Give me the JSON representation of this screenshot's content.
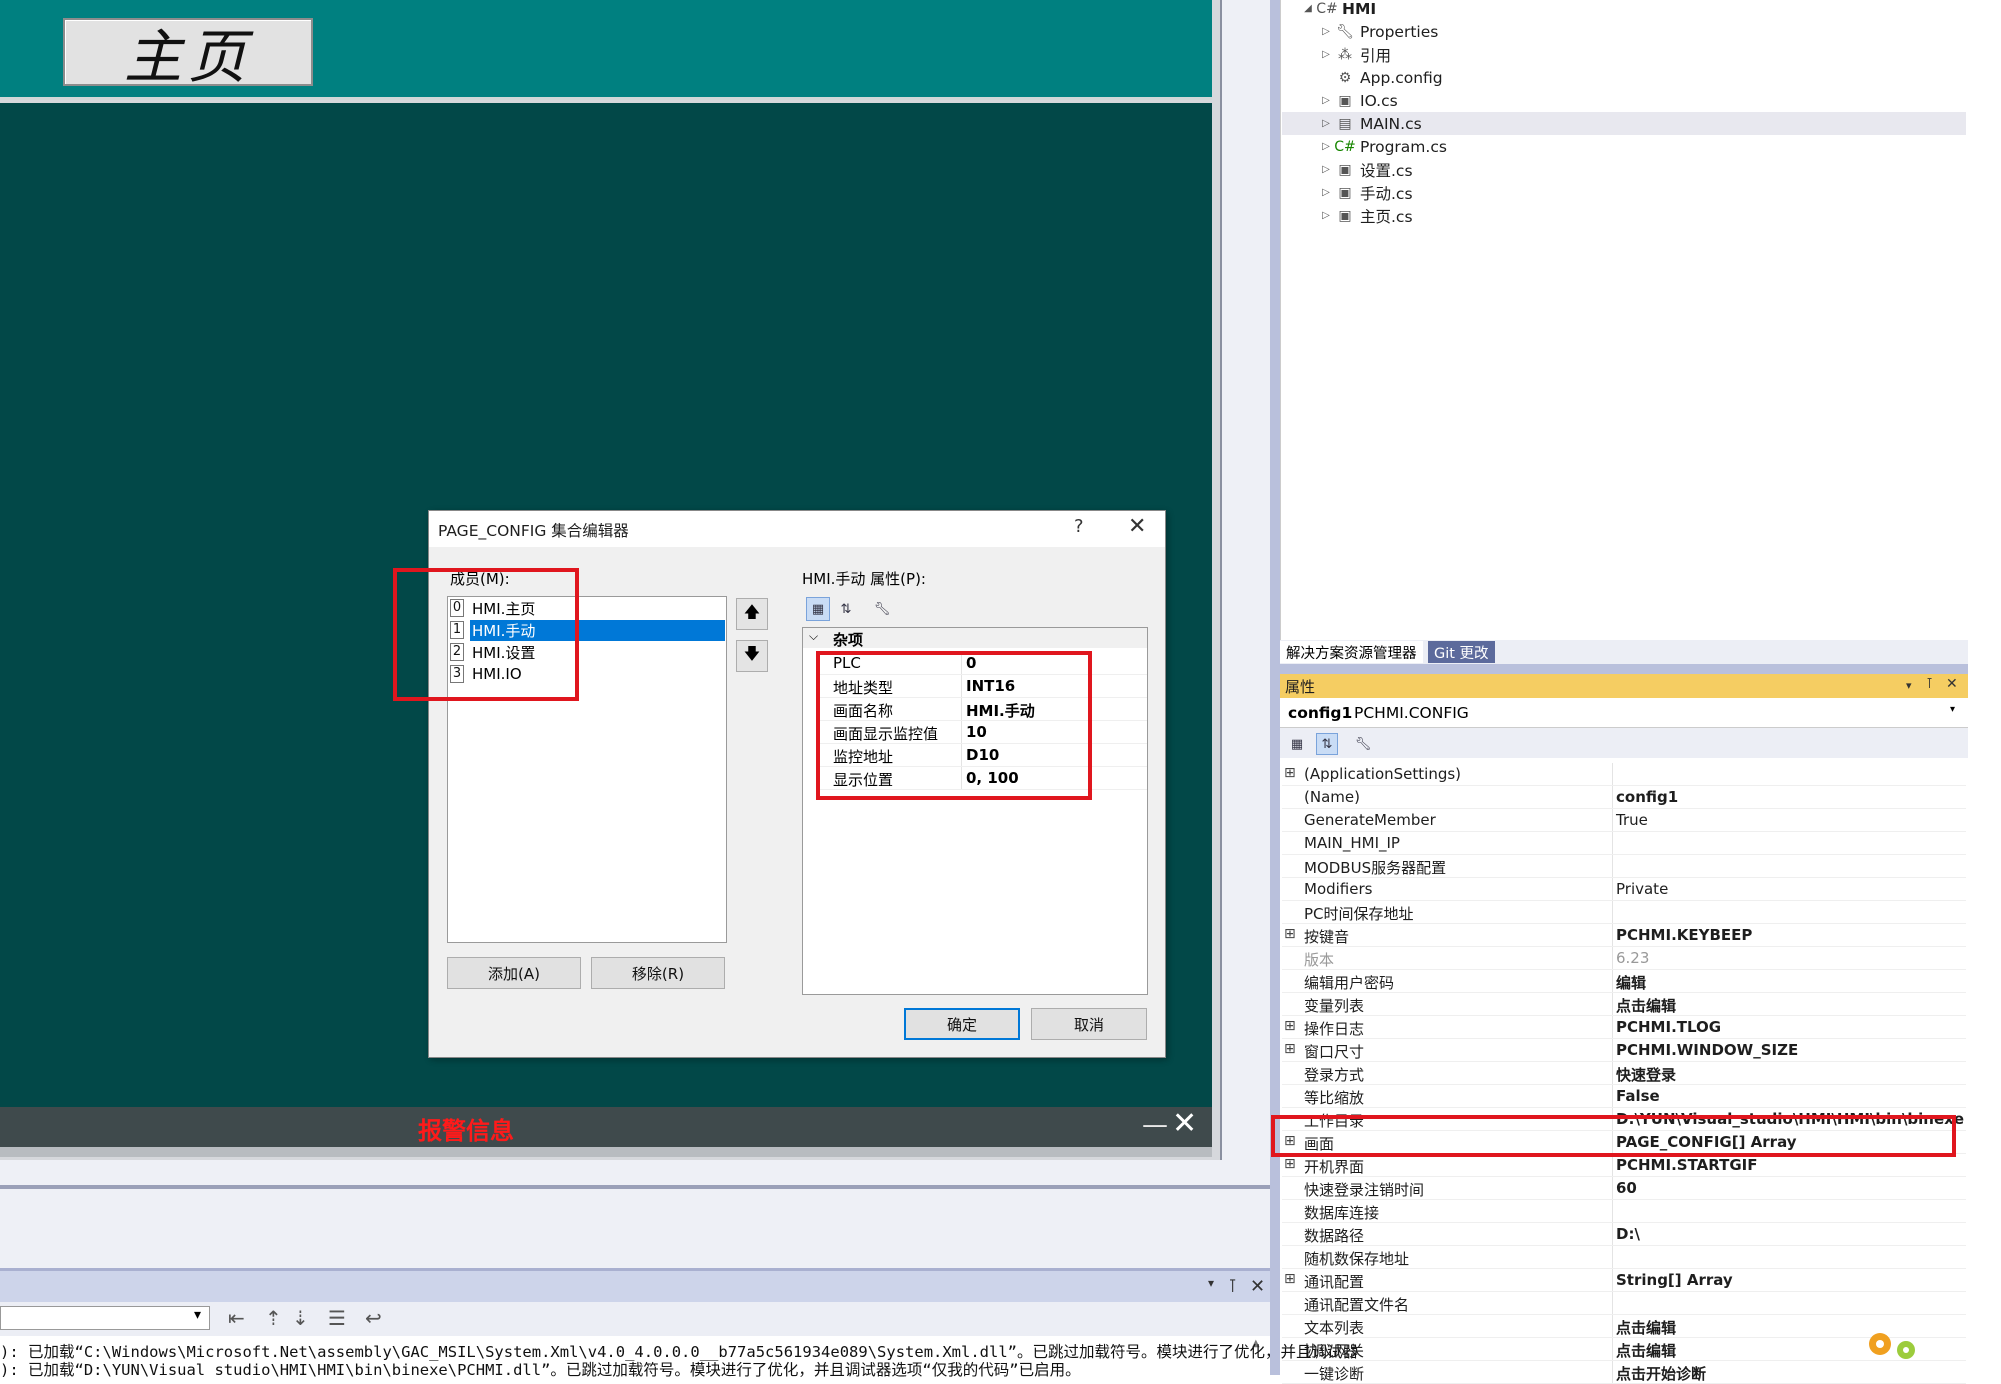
{
  "hmi": {
    "home_button": "主页",
    "alarm_title": "报警信息",
    "alarm_min": "—",
    "alarm_close": "✕"
  },
  "solution_explorer": {
    "items": [
      {
        "label": "HMI",
        "icon": "csharp-project-icon",
        "bold": true
      },
      {
        "label": "Properties",
        "icon": "wrench-icon"
      },
      {
        "label": "引用",
        "icon": "references-icon"
      },
      {
        "label": "App.config",
        "icon": "config-file-icon"
      },
      {
        "label": "IO.cs",
        "icon": "form-icon"
      },
      {
        "label": "MAIN.cs",
        "icon": "component-icon"
      },
      {
        "label": "Program.cs",
        "icon": "csharp-file-icon"
      },
      {
        "label": "设置.cs",
        "icon": "form-icon"
      },
      {
        "label": "手动.cs",
        "icon": "form-icon"
      },
      {
        "label": "主页.cs",
        "icon": "form-icon"
      }
    ],
    "tabs": [
      "解决方案资源管理器",
      "Git 更改"
    ]
  },
  "properties": {
    "title": "属性",
    "object_name": "config1",
    "object_type": "PCHMI.CONFIG",
    "rows": [
      {
        "expand": "⊞",
        "name": "(ApplicationSettings)",
        "value": ""
      },
      {
        "expand": "",
        "name": "(Name)",
        "value": "config1",
        "bold": true
      },
      {
        "expand": "",
        "name": "GenerateMember",
        "value": "True"
      },
      {
        "expand": "",
        "name": "MAIN_HMI_IP",
        "value": ""
      },
      {
        "expand": "",
        "name": "MODBUS服务器配置",
        "value": ""
      },
      {
        "expand": "",
        "name": "Modifiers",
        "value": "Private"
      },
      {
        "expand": "",
        "name": "PC时间保存地址",
        "value": ""
      },
      {
        "expand": "⊞",
        "name": "按键音",
        "value": "PCHMI.KEYBEEP",
        "bold": true
      },
      {
        "expand": "",
        "name": "版本",
        "value": "6.23",
        "gray": true
      },
      {
        "expand": "",
        "name": "编辑用户密码",
        "value": "编辑",
        "bold": true
      },
      {
        "expand": "",
        "name": "变量列表",
        "value": "点击编辑",
        "bold": true
      },
      {
        "expand": "⊞",
        "name": "操作日志",
        "value": "PCHMI.TLOG",
        "bold": true
      },
      {
        "expand": "⊞",
        "name": "窗口尺寸",
        "value": "PCHMI.WINDOW_SIZE",
        "bold": true
      },
      {
        "expand": "",
        "name": "登录方式",
        "value": "快速登录",
        "bold": true
      },
      {
        "expand": "",
        "name": "等比缩放",
        "value": "False",
        "bold": true
      },
      {
        "expand": "",
        "name": "工作目录",
        "value": "D:\\YUN\\Visual_studio\\HMI\\HMI\\bin\\binexe",
        "bold": true
      },
      {
        "expand": "⊞",
        "name": "画面",
        "value": "PAGE_CONFIG[] Array",
        "bold": true
      },
      {
        "expand": "⊞",
        "name": "开机界面",
        "value": "PCHMI.STARTGIF",
        "bold": true
      },
      {
        "expand": "",
        "name": "快速登录注销时间",
        "value": "60",
        "bold": true
      },
      {
        "expand": "",
        "name": "数据库连接",
        "value": ""
      },
      {
        "expand": "",
        "name": "数据路径",
        "value": "D:\\",
        "bold": true
      },
      {
        "expand": "",
        "name": "随机数保存地址",
        "value": ""
      },
      {
        "expand": "⊞",
        "name": "通讯配置",
        "value": "String[] Array",
        "bold": true
      },
      {
        "expand": "",
        "name": "通讯配置文件名",
        "value": ""
      },
      {
        "expand": "",
        "name": "文本列表",
        "value": "点击编辑",
        "bold": true
      },
      {
        "expand": "",
        "name": "协议网关",
        "value": "点击编辑",
        "bold": true
      },
      {
        "expand": "",
        "name": "一键诊断",
        "value": "点击开始诊断",
        "bold": true
      }
    ]
  },
  "dialog": {
    "title": "PAGE_CONFIG 集合编辑器",
    "help": "?",
    "close": "✕",
    "members_label": "成员(M):",
    "members": [
      {
        "index": "0",
        "label": "HMI.主页"
      },
      {
        "index": "1",
        "label": "HMI.手动",
        "selected": true
      },
      {
        "index": "2",
        "label": "HMI.设置"
      },
      {
        "index": "3",
        "label": "HMI.IO"
      }
    ],
    "add_button": "添加(A)",
    "remove_button": "移除(R)",
    "props_label": "HMI.手动 属性(P):",
    "category": "杂项",
    "props": [
      {
        "name": "PLC",
        "value": "0"
      },
      {
        "name": "地址类型",
        "value": "INT16"
      },
      {
        "name": "画面名称",
        "value": "HMI.手动"
      },
      {
        "name": "画面显示监控值",
        "value": "10"
      },
      {
        "name": "监控地址",
        "value": "D10"
      },
      {
        "name": "显示位置",
        "value": "0, 100"
      }
    ],
    "ok_button": "确定",
    "cancel_button": "取消"
  },
  "output": {
    "lines": [
      "): 已加载“C:\\Windows\\Microsoft.Net\\assembly\\GAC_MSIL\\System.Xml\\v4.0_4.0.0.0__b77a5c561934e089\\System.Xml.dll”。已跳过加载符号。模块进行了优化，并且调试器",
      "): 已加载“D:\\YUN\\Visual studio\\HMI\\HMI\\bin\\binexe\\PCHMI.dll”。已跳过加载符号。模块进行了优化，并且调试器选项“仅我的代码”已启用。"
    ]
  },
  "colors": {
    "hmi_header": "#008080",
    "hmi_main": "#024848",
    "alarm_text": "#ff1a1a",
    "highlight": "#e0161e",
    "selection": "#0078d7",
    "properties_title": "#f5cd62"
  }
}
